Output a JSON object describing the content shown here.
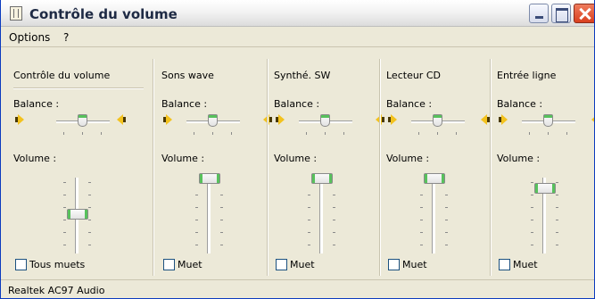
{
  "window": {
    "title": "Contrôle du volume",
    "controls": {
      "minimize": "minimize-icon",
      "maximize": "maximize-icon",
      "close": "close-icon"
    }
  },
  "menu": {
    "options": "Options",
    "help": "?"
  },
  "labels": {
    "balance": "Balance :",
    "volume": "Volume :"
  },
  "channels": [
    {
      "name": "Contrôle du volume",
      "mute_label": "Tous muets",
      "muted": false,
      "balance": 0.5,
      "volume": 0.45
    },
    {
      "name": "Sons wave",
      "mute_label": "Muet",
      "muted": false,
      "balance": 0.5,
      "volume": 1.0
    },
    {
      "name": "Synthé. SW",
      "mute_label": "Muet",
      "muted": false,
      "balance": 0.5,
      "volume": 1.0
    },
    {
      "name": "Lecteur CD",
      "mute_label": "Muet",
      "muted": false,
      "balance": 0.5,
      "volume": 1.0
    },
    {
      "name": "Entrée ligne",
      "mute_label": "Muet",
      "muted": false,
      "balance": 0.5,
      "volume": 0.8
    }
  ],
  "status": {
    "text": "Realtek AC97 Audio"
  },
  "colors": {
    "thumb_accent": "#58c15c",
    "speaker": "#f3c21e"
  }
}
